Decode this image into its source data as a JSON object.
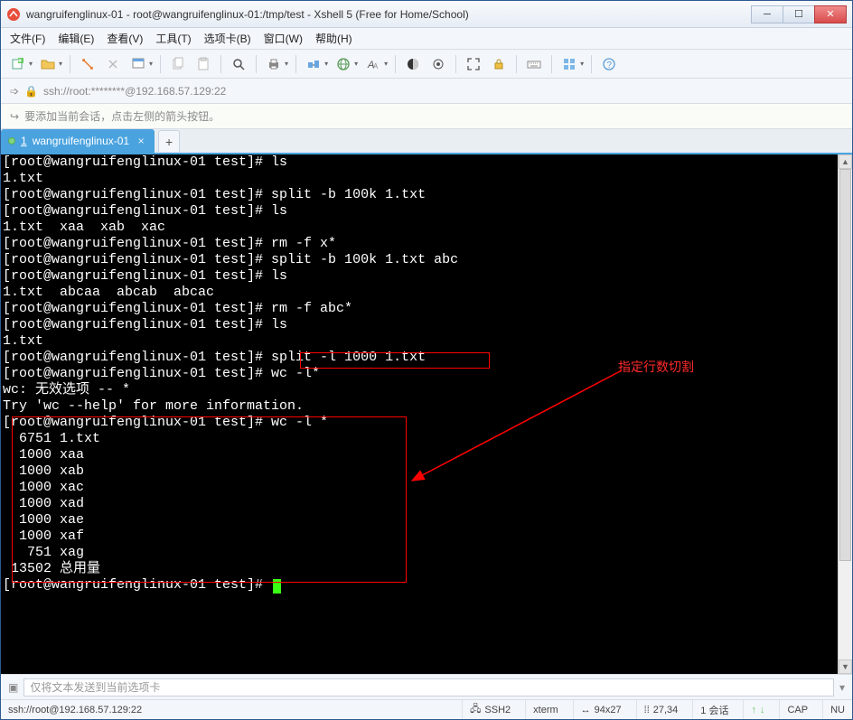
{
  "window": {
    "title": "wangruifenglinux-01 - root@wangruifenglinux-01:/tmp/test - Xshell 5 (Free for Home/School)"
  },
  "menus": {
    "file": "文件(F)",
    "edit": "编辑(E)",
    "view": "查看(V)",
    "tools": "工具(T)",
    "tab": "选项卡(B)",
    "window": "窗口(W)",
    "help": "帮助(H)"
  },
  "address": {
    "text": "ssh://root:********@192.168.57.129:22"
  },
  "infobar": {
    "text": "要添加当前会话，点击左侧的箭头按钮。"
  },
  "tab": {
    "num": "1",
    "label": "wangruifenglinux-01"
  },
  "annotation": {
    "label": "指定行数切割"
  },
  "prompt": "[root@wangruifenglinux-01 test]# ",
  "terminal": {
    "lines": [
      {
        "t": "prompt",
        "cmd": "ls"
      },
      {
        "t": "out",
        "text": "1.txt"
      },
      {
        "t": "prompt",
        "cmd": "split -b 100k 1.txt"
      },
      {
        "t": "prompt",
        "cmd": "ls"
      },
      {
        "t": "out",
        "text": "1.txt  xaa  xab  xac"
      },
      {
        "t": "prompt",
        "cmd": "rm -f x*"
      },
      {
        "t": "prompt",
        "cmd": "split -b 100k 1.txt abc"
      },
      {
        "t": "prompt",
        "cmd": "ls"
      },
      {
        "t": "out",
        "text": "1.txt  abcaa  abcab  abcac"
      },
      {
        "t": "prompt",
        "cmd": "rm -f abc*"
      },
      {
        "t": "prompt",
        "cmd": "ls"
      },
      {
        "t": "out",
        "text": "1.txt"
      },
      {
        "t": "prompt",
        "cmd": "split -l 1000 1.txt"
      },
      {
        "t": "prompt",
        "cmd": "wc -l*"
      },
      {
        "t": "out",
        "text": "wc: 无效选项 -- *"
      },
      {
        "t": "out",
        "text": "Try 'wc --help' for more information."
      },
      {
        "t": "prompt",
        "cmd": "wc -l *"
      },
      {
        "t": "out",
        "text": "  6751 1.txt"
      },
      {
        "t": "out",
        "text": "  1000 xaa"
      },
      {
        "t": "out",
        "text": "  1000 xab"
      },
      {
        "t": "out",
        "text": "  1000 xac"
      },
      {
        "t": "out",
        "text": "  1000 xad"
      },
      {
        "t": "out",
        "text": "  1000 xae"
      },
      {
        "t": "out",
        "text": "  1000 xaf"
      },
      {
        "t": "out",
        "text": "   751 xag"
      },
      {
        "t": "out",
        "text": " 13502 总用量"
      },
      {
        "t": "prompt",
        "cmd": "",
        "cursor": true
      }
    ]
  },
  "inputbar": {
    "placeholder": "仅将文本发送到当前选项卡"
  },
  "status": {
    "conn": "ssh://root@192.168.57.129:22",
    "proto": "SSH2",
    "term": "xterm",
    "size": "94x27",
    "pos": "27,34",
    "sessions": "1 会话",
    "cap": "CAP",
    "num": "NU"
  }
}
